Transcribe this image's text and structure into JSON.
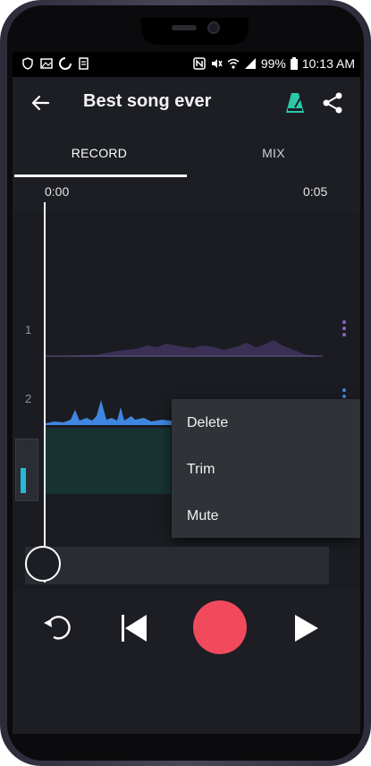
{
  "status_bar": {
    "battery": "99%",
    "time": "10:13 AM"
  },
  "app_bar": {
    "title": "Best song ever",
    "back_icon": "arrow-back-icon",
    "metronome_icon": "metronome-icon",
    "share_icon": "share-icon",
    "accent_color": "#2cc8a8"
  },
  "tabs": [
    {
      "label": "RECORD",
      "selected": true
    },
    {
      "label": "MIX",
      "selected": false
    }
  ],
  "timeline": {
    "start": "0:00",
    "end": "0:05"
  },
  "tracks": [
    {
      "number": "1",
      "color": "#3a2f55",
      "dots_color": "#8a63c9"
    },
    {
      "number": "2",
      "color": "#3f86e0",
      "dots_color": "#3f86e0"
    }
  ],
  "level_meter": {
    "level": 0.4,
    "color": "#29b9d4"
  },
  "context_menu": {
    "items": [
      "Delete",
      "Trim",
      "Mute"
    ]
  },
  "transport": {
    "undo_icon": "undo-icon",
    "skip_back_icon": "skip-back-icon",
    "record_icon": "record-icon",
    "play_icon": "play-icon",
    "record_color": "#f24a5d"
  }
}
